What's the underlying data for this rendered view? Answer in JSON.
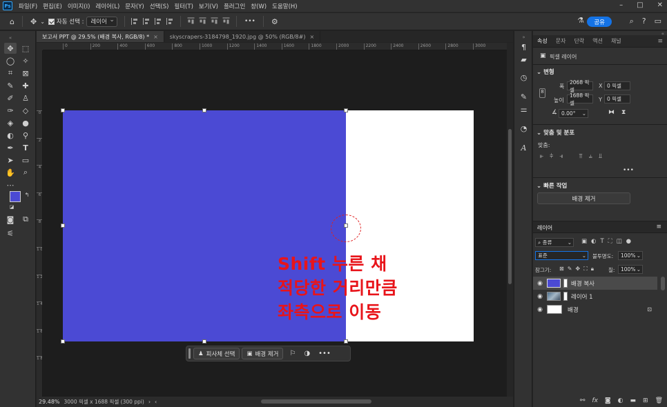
{
  "menubar": {
    "logo": "Ps",
    "items": [
      "파일(F)",
      "편집(E)",
      "이미지(I)",
      "레이어(L)",
      "문자(Y)",
      "선택(S)",
      "필터(T)",
      "보기(V)",
      "플러그인",
      "창(W)",
      "도움말(H)"
    ],
    "controls": [
      "–",
      "□",
      "✕"
    ]
  },
  "optionsbar": {
    "auto_select_label": "자동 선택 :",
    "auto_select_target": "레이어",
    "more": "•••",
    "share_label": "공유"
  },
  "tabs": [
    {
      "label": "보고서 PPT @ 29.5% (배경 복사, RGB/8) *",
      "active": true
    },
    {
      "label": "skyscrapers-3184798_1920.jpg @ 50% (RGB/8#)",
      "active": false
    }
  ],
  "ruler": {
    "top": [
      "0",
      "200",
      "400",
      "600",
      "800",
      "1000",
      "1200",
      "1400",
      "1600",
      "1800",
      "2000",
      "2200",
      "2400",
      "2600",
      "2800",
      "3000"
    ],
    "left": [
      "0",
      "2",
      "4",
      "6",
      "8",
      "1 0",
      "1 2",
      "1 4",
      "1 6",
      "1 8"
    ]
  },
  "annotation": {
    "lines": [
      "Shift 누른 채",
      "적당한 거리만큼",
      "좌측으로 이동"
    ],
    "color": "#e8141a"
  },
  "contextbar": {
    "select_subject": "피사체 선택",
    "remove_bg": "배경 제거",
    "more": "•••"
  },
  "status": {
    "zoom": "29.48%",
    "doc_info": "3000 픽셀 x 1688 픽셀 (300 ppi)"
  },
  "properties": {
    "tabs": [
      "속성",
      "문자",
      "단락",
      "액션",
      "채널"
    ],
    "layer_type": "픽셀 레이어",
    "transform_title": "변형",
    "width_label": "폭",
    "width_value": "2068 픽셀",
    "height_label": "높이",
    "height_value": "1688 픽셀",
    "x_label": "X",
    "x_value": "0 픽셀",
    "y_label": "Y",
    "y_value": "0 픽셀",
    "angle_value": "0.00°",
    "align_title": "맞춤 및 분포",
    "align_label": "맞춤:",
    "more": "•••",
    "quick_title": "빠른 작업",
    "remove_bg_btn": "배경 제거"
  },
  "layers": {
    "title": "레이어",
    "filter_label": "종류",
    "blend_mode": "표준",
    "opacity_label": "불투명도:",
    "opacity_value": "100%",
    "lock_label": "잠그기:",
    "fill_label": "칠:",
    "fill_value": "100%",
    "items": [
      {
        "name": "배경 복사",
        "selected": true,
        "thumb": "#4b4ad4"
      },
      {
        "name": "레이어 1",
        "selected": false,
        "thumb": "#6a7f96"
      },
      {
        "name": "배경",
        "selected": false,
        "thumb": "#ffffff",
        "locked": true
      }
    ]
  },
  "colors": {
    "foreground": "#4b4ad4",
    "background": "#000000",
    "accent": "#1473e6"
  }
}
